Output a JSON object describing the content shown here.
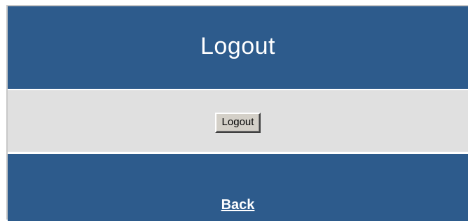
{
  "header": {
    "title": "Logout"
  },
  "content": {
    "logout_button_label": "Logout"
  },
  "footer": {
    "back_link_label": "Back"
  },
  "colors": {
    "panel_blue": "#2d5b8c",
    "content_gray": "#e0e0e0",
    "button_face": "#d4d0c8",
    "text_white": "#ffffff"
  }
}
